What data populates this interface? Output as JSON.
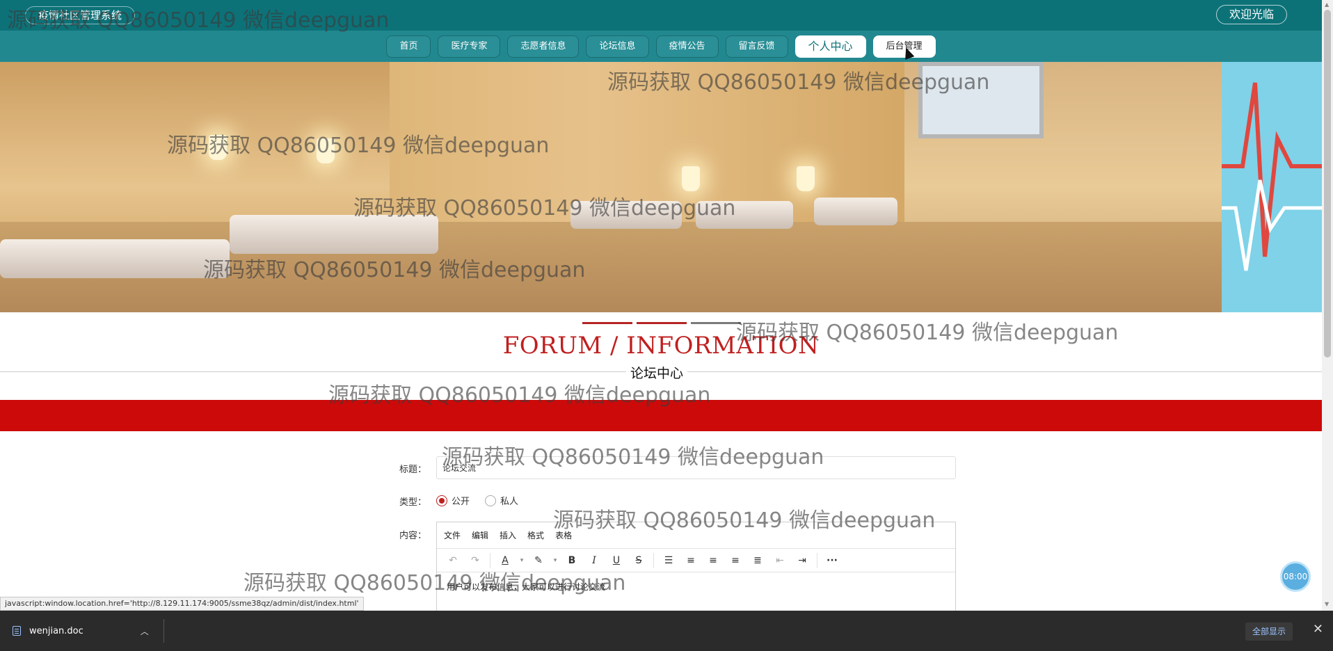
{
  "header": {
    "site_title": "疫情社区管理系统",
    "welcome": "欢迎光临"
  },
  "nav": {
    "items": [
      "首页",
      "医疗专家",
      "志愿者信息",
      "论坛信息",
      "疫情公告",
      "留言反馈"
    ],
    "personal_center": "个人中心",
    "admin": "后台管理"
  },
  "section": {
    "title_en": "FORUM / INFORMATION",
    "title_cn": "论坛中心"
  },
  "form": {
    "title_label": "标题：",
    "title_value": "论坛交流",
    "type_label": "类型：",
    "type_options": [
      "公开",
      "私人"
    ],
    "type_selected": "公开",
    "content_label": "内容：",
    "editor_menu": [
      "文件",
      "编辑",
      "插入",
      "格式",
      "表格"
    ],
    "content_text": "用户可以发布信息，大家可以进行讨论交流"
  },
  "clock": "08:00",
  "status_url": "javascript:window.location.href='http://8.129.11.174:9005/ssme38qz/admin/dist/index.html'",
  "downloads": {
    "file_name": "wenjian.doc",
    "show_all": "全部显示"
  },
  "watermark": "源码获取 QQ86050149 微信deepguan"
}
